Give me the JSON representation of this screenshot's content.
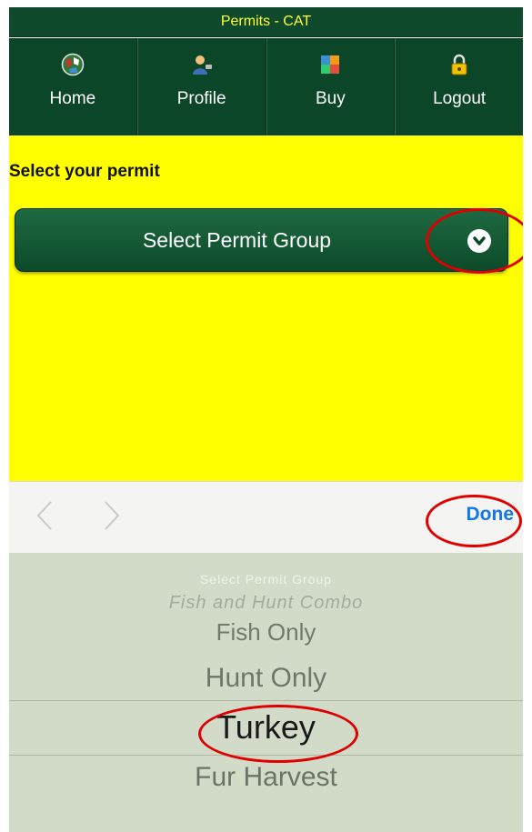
{
  "app": {
    "title": "Permits - CAT"
  },
  "nav": {
    "items": [
      {
        "label": "Home",
        "icon": "home-globe-icon"
      },
      {
        "label": "Profile",
        "icon": "profile-icon"
      },
      {
        "label": "Buy",
        "icon": "buy-icon"
      },
      {
        "label": "Logout",
        "icon": "lock-icon"
      }
    ]
  },
  "form": {
    "section_label": "Select your permit",
    "select_label": "Select Permit Group"
  },
  "toolbar": {
    "done_label": "Done"
  },
  "picker": {
    "options": [
      "Select Permit Group",
      "Fish and Hunt Combo",
      "Fish Only",
      "Hunt Only",
      "Turkey",
      "Fur Harvest"
    ],
    "selected": "Turkey"
  },
  "colors": {
    "header_green": "#0c4628",
    "title_text": "#ffff33",
    "content_bg": "#ffff00",
    "button_green": "#1a5e3a",
    "done_blue": "#1576e6",
    "picker_bg": "#d2dbc8",
    "annotation_red": "#e00000"
  }
}
